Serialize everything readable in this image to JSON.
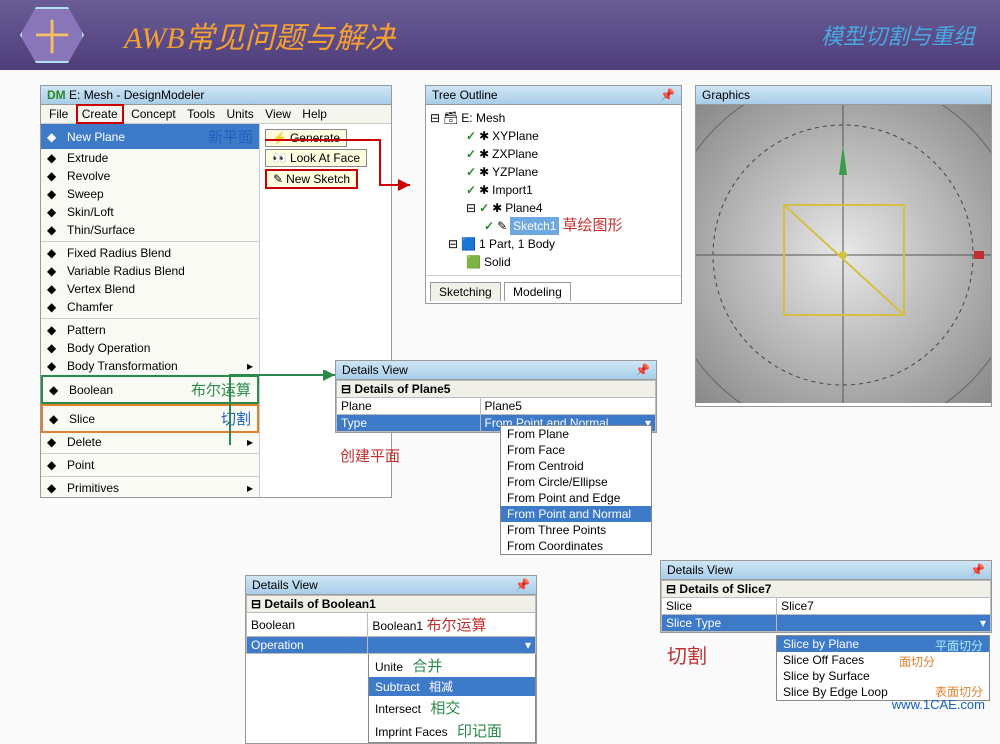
{
  "banner": {
    "badge": "十",
    "title": "AWB常见问题与解决",
    "right": "模型切割与重组"
  },
  "dm": {
    "title": "E: Mesh - DesignModeler",
    "menus": [
      "File",
      "Create",
      "Concept",
      "Tools",
      "Units",
      "View",
      "Help"
    ],
    "create_items": [
      {
        "t": "New Plane",
        "ann": "新平面",
        "sel": true
      },
      {
        "t": "Extrude"
      },
      {
        "t": "Revolve"
      },
      {
        "t": "Sweep"
      },
      {
        "t": "Skin/Loft"
      },
      {
        "t": "Thin/Surface"
      },
      {
        "sep": true
      },
      {
        "t": "Fixed Radius Blend"
      },
      {
        "t": "Variable Radius Blend"
      },
      {
        "t": "Vertex Blend"
      },
      {
        "t": "Chamfer"
      },
      {
        "sep": true
      },
      {
        "t": "Pattern"
      },
      {
        "t": "Body Operation"
      },
      {
        "t": "Body Transformation",
        "arrow": true
      },
      {
        "t": "Boolean",
        "ann": "布尔运算",
        "box": "grn"
      },
      {
        "t": "Slice",
        "ann": "切割",
        "box": "org"
      },
      {
        "t": "Delete",
        "arrow": true
      },
      {
        "sep": true
      },
      {
        "t": "Point"
      },
      {
        "sep": true
      },
      {
        "t": "Primitives",
        "arrow": true
      }
    ],
    "buttons": {
      "gen": "Generate",
      "look": "Look At Face",
      "sketch": "New Sketch"
    }
  },
  "tree": {
    "title": "Tree Outline",
    "root": "E: Mesh",
    "items": [
      "XYPlane",
      "ZXPlane",
      "YZPlane",
      "Import1",
      "Plane4"
    ],
    "sketch": "Sketch1",
    "sketch_ann": "草绘图形",
    "parts": "1 Part, 1 Body",
    "solid": "Solid",
    "tabs": [
      "Sketching",
      "Modeling"
    ]
  },
  "graphics": {
    "title": "Graphics"
  },
  "dv_plane": {
    "title": "Details View",
    "header": "Details of Plane5",
    "rows": [
      [
        "Plane",
        "Plane5"
      ],
      [
        "Type",
        "From Point and Normal"
      ]
    ],
    "ann": "创建平面",
    "options": [
      "From Plane",
      "From Face",
      "From Centroid",
      "From Circle/Ellipse",
      "From Point and Edge",
      "From Point and Normal",
      "From Three Points",
      "From Coordinates"
    ],
    "selected": "From Point and Normal"
  },
  "dv_bool": {
    "title": "Details View",
    "header": "Details of Boolean1",
    "rows": [
      [
        "Boolean",
        "Boolean1"
      ],
      [
        "Operation",
        ""
      ]
    ],
    "ann": "布尔运算",
    "options": [
      {
        "t": "Unite",
        "a": "合并"
      },
      {
        "t": "Subtract",
        "a": "相减",
        "sel": true
      },
      {
        "t": "Intersect",
        "a": "相交"
      },
      {
        "t": "Imprint Faces",
        "a": "印记面"
      }
    ]
  },
  "dv_slice": {
    "title": "Details View",
    "header": "Details of Slice7",
    "rows": [
      [
        "Slice",
        "Slice7"
      ],
      [
        "Slice Type",
        ""
      ]
    ],
    "ann": "切割",
    "options": [
      {
        "t": "Slice by Plane",
        "a": "平面切分",
        "sel": true
      },
      {
        "t": "Slice Off Faces",
        "a": "面切分"
      },
      {
        "t": "Slice by Surface",
        "a": "表面切分"
      },
      {
        "t": "Slice By Edge Loop",
        "a": ""
      }
    ]
  },
  "watermark": "www.1CAE.com"
}
